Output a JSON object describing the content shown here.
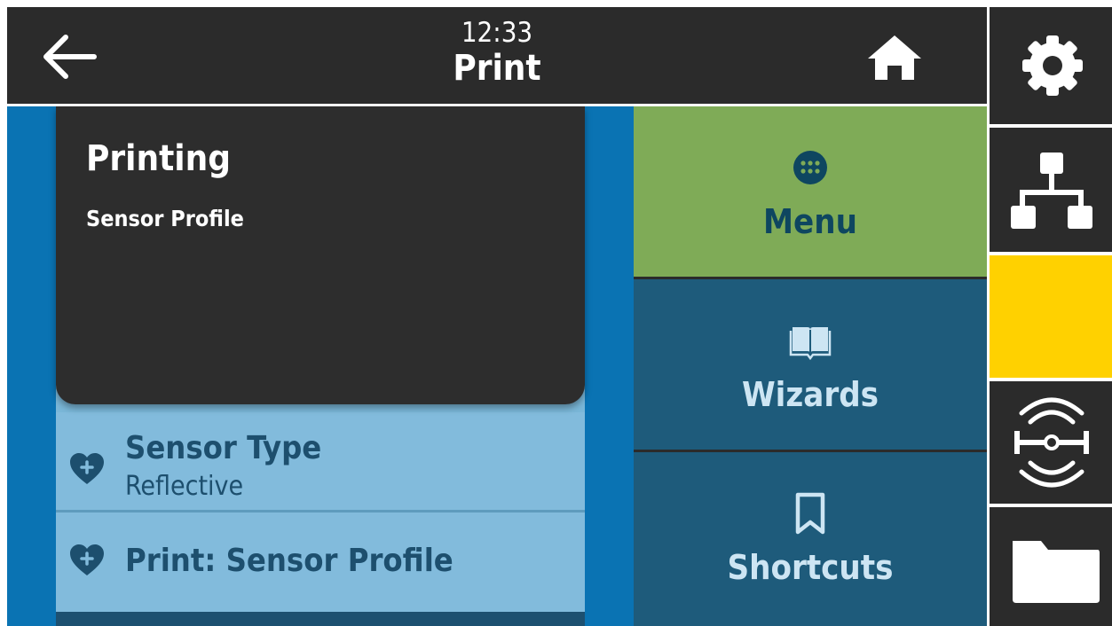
{
  "header": {
    "time": "12:33",
    "title": "Print",
    "back_icon": "arrow-left-icon",
    "home_icon": "home-icon"
  },
  "popup": {
    "title": "Printing",
    "subtitle": "Sensor Profile"
  },
  "list": {
    "items": [
      {
        "title": "Sensor Type",
        "value": "Reflective",
        "icon": "heart-plus-icon"
      },
      {
        "title": "Print: Sensor Profile",
        "icon": "heart-plus-icon"
      }
    ]
  },
  "nav": {
    "menu": {
      "label": "Menu",
      "icon": "grid-circle-icon",
      "color": "#7fab57"
    },
    "wizards": {
      "label": "Wizards",
      "icon": "book-icon",
      "color": "#1e5b7b"
    },
    "shortcuts": {
      "label": "Shortcuts",
      "icon": "bookmark-icon",
      "color": "#1e5b7b"
    }
  },
  "sidebar": {
    "icons": [
      "gear-icon",
      "network-icon",
      "status-indicator",
      "rfid-icon",
      "folder-icon"
    ],
    "status_color": "#ffd100"
  },
  "colors": {
    "background": "#2b2b2b",
    "list_area": "#0a73b3",
    "list_item": "#82bbdc",
    "text_dark_blue": "#1d4f6e"
  }
}
